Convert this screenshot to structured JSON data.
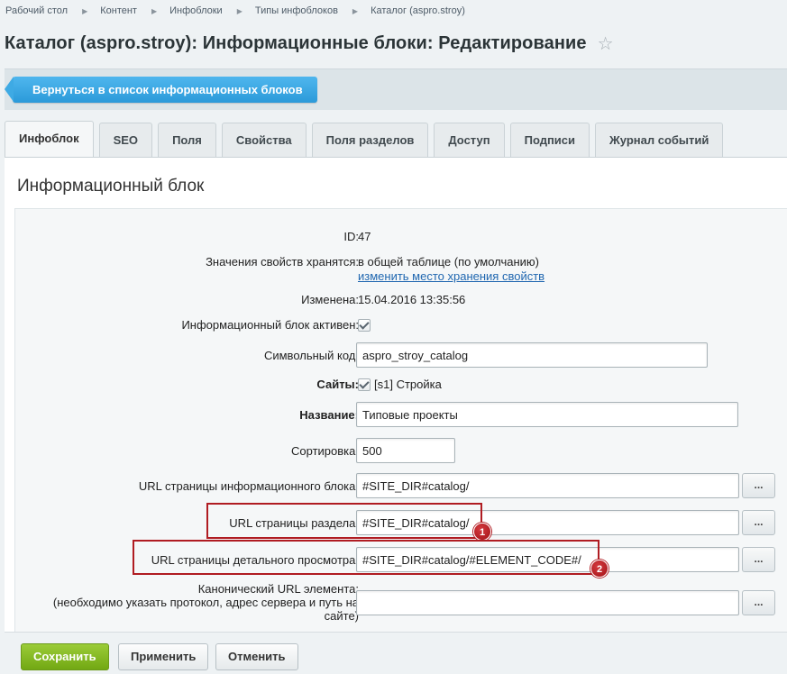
{
  "breadcrumb": [
    "Рабочий стол",
    "Контент",
    "Инфоблоки",
    "Типы инфоблоков",
    "Каталог (aspro.stroy)"
  ],
  "page_title": "Каталог (aspro.stroy): Информационные блоки: Редактирование",
  "back_button": "Вернуться в список информационных блоков",
  "tabs": [
    "Инфоблок",
    "SEO",
    "Поля",
    "Свойства",
    "Поля разделов",
    "Доступ",
    "Подписи",
    "Журнал событий"
  ],
  "section_title": "Информационный блок",
  "fields": {
    "id_label": "ID:",
    "id_value": "47",
    "storage_label": "Значения свойств хранятся:",
    "storage_value": "в общей таблице (по умолчанию)",
    "storage_link": "изменить место хранения свойств",
    "modified_label": "Изменена:",
    "modified_value": "15.04.2016 13:35:56",
    "active_label": "Информационный блок активен:",
    "code_label": "Символьный код:",
    "code_value": "aspro_stroy_catalog",
    "sites_label": "Сайты:",
    "sites_value": "[s1] Стройка",
    "name_label": "Название:",
    "name_value": "Типовые проекты",
    "sort_label": "Сортировка:",
    "sort_value": "500",
    "list_url_label": "URL страницы информационного блока:",
    "list_url_value": "#SITE_DIR#catalog/",
    "section_url_label": "URL страницы раздела:",
    "section_url_value": "#SITE_DIR#catalog/",
    "detail_url_label": "URL страницы детального просмотра:",
    "detail_url_value": "#SITE_DIR#catalog/#ELEMENT_CODE#/",
    "canonical_label_1": "Канонический URL элемента:",
    "canonical_label_2": "(необходимо указать протокол, адрес сервера и путь на",
    "canonical_label_3": "сайте)",
    "canonical_value": "",
    "dots": "..."
  },
  "markers": [
    "1",
    "2"
  ],
  "footer": {
    "save": "Сохранить",
    "apply": "Применить",
    "cancel": "Отменить"
  }
}
